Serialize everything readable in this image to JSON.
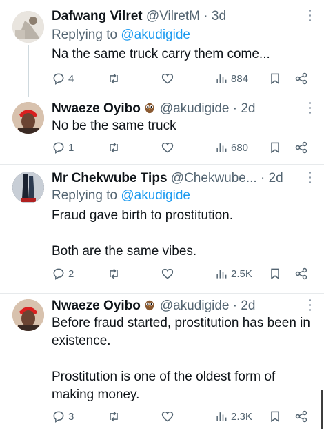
{
  "tweets": [
    {
      "name": "Dafwang Vilret",
      "handle": "@VilretM",
      "time": "· 3d",
      "replying_prefix": "Replying to ",
      "replying_to": "@akudigide",
      "body": [
        "Na the same truck carry them come..."
      ],
      "replies": "4",
      "views": "884"
    },
    {
      "name": "Nwaeze Oyibo",
      "handle": "@akudigide",
      "time": "· 2d",
      "body": [
        "No be the same truck"
      ],
      "replies": "1",
      "views": "680"
    },
    {
      "name": "Mr Chekwube Tips",
      "handle": "@Chekwube...",
      "time": "· 2d",
      "replying_prefix": "Replying to ",
      "replying_to": "@akudigide",
      "body": [
        "Fraud gave birth to prostitution.",
        "Both are the same vibes."
      ],
      "replies": "2",
      "views": "2.5K"
    },
    {
      "name": "Nwaeze Oyibo",
      "handle": "@akudigide",
      "time": "· 2d",
      "body": [
        "Before fraud started, prostitution has been in existence.",
        "Prostitution is one of the oldest form of making money."
      ],
      "replies": "3",
      "views": "2.3K"
    }
  ],
  "colors": {
    "link": "#1d9bf0",
    "muted": "#536471",
    "text": "#0f1419",
    "divider": "#e7eaec"
  },
  "icons": [
    "reply-icon",
    "retweet-icon",
    "like-icon",
    "views-icon",
    "bookmark-icon",
    "share-icon",
    "more-icon",
    "owl-emoji-icon"
  ]
}
